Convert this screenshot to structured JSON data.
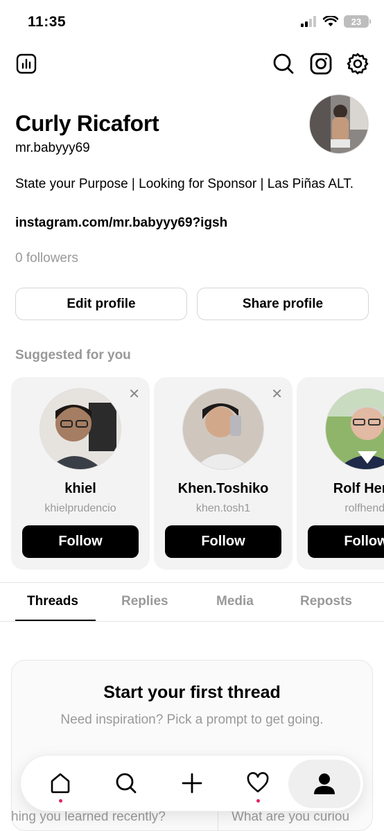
{
  "status_bar": {
    "time": "11:35",
    "battery": "23"
  },
  "profile": {
    "name": "Curly Ricafort",
    "handle": "mr.babyyy69",
    "bio": "State your Purpose | Looking for Sponsor | Las Piñas ALT.",
    "link": "instagram.com/mr.babyyy69?igsh",
    "followers": "0 followers"
  },
  "actions": {
    "edit": "Edit profile",
    "share": "Share profile"
  },
  "suggested": {
    "title": "Suggested for you",
    "cards": [
      {
        "name": "khiel",
        "handle": "khielprudencio",
        "button": "Follow"
      },
      {
        "name": "Khen.Toshiko",
        "handle": "khen.tosh1",
        "button": "Follow"
      },
      {
        "name": "Rolf Hend",
        "handle": "rolfhendl",
        "button": "Follow"
      }
    ]
  },
  "tabs": [
    "Threads",
    "Replies",
    "Media",
    "Reposts"
  ],
  "starter": {
    "title": "Start your first thread",
    "subtitle": "Need inspiration? Pick a prompt to get going.",
    "prompts": [
      "hing you learned recently?",
      "What are you curiou"
    ]
  },
  "icons": {
    "top": [
      "insights-icon",
      "search-icon",
      "instagram-icon",
      "settings-icon"
    ],
    "nav": [
      "home-icon",
      "search-icon",
      "compose-icon",
      "activity-icon",
      "profile-icon"
    ]
  },
  "colors": {
    "notification_dot": "#e0245e",
    "muted_text": "#999999"
  }
}
